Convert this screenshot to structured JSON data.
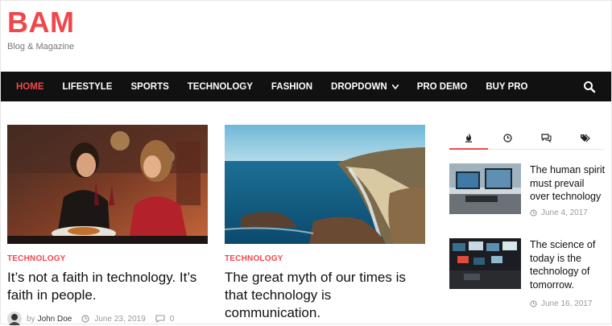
{
  "site": {
    "title": "BAM",
    "tagline": "Blog & Magazine"
  },
  "nav": {
    "items": [
      "HOME",
      "LIFESTYLE",
      "SPORTS",
      "TECHNOLOGY",
      "FASHION",
      "DROPDOWN",
      "PRO DEMO",
      "BUY PRO"
    ],
    "active": "HOME"
  },
  "posts": [
    {
      "category": "TECHNOLOGY",
      "title": "It’s not a faith in technology. It’s faith in people.",
      "author_prefix": "by",
      "author": "John Doe",
      "date": "June 23, 2019",
      "comments": "0"
    },
    {
      "category": "TECHNOLOGY",
      "title": "The great myth of our times is that technology is communication."
    }
  ],
  "sidebar": {
    "tabs": [
      "flame-icon",
      "clock-icon",
      "comments-icon",
      "tags-icon"
    ],
    "items": [
      {
        "title": "The human spirit must prevail over technology",
        "date": "June 4, 2017"
      },
      {
        "title": "The science of today is the technology of tomorrow.",
        "date": "June 16, 2017"
      }
    ]
  },
  "colors": {
    "accent": "#f0474a",
    "nav_bg": "#111111"
  }
}
